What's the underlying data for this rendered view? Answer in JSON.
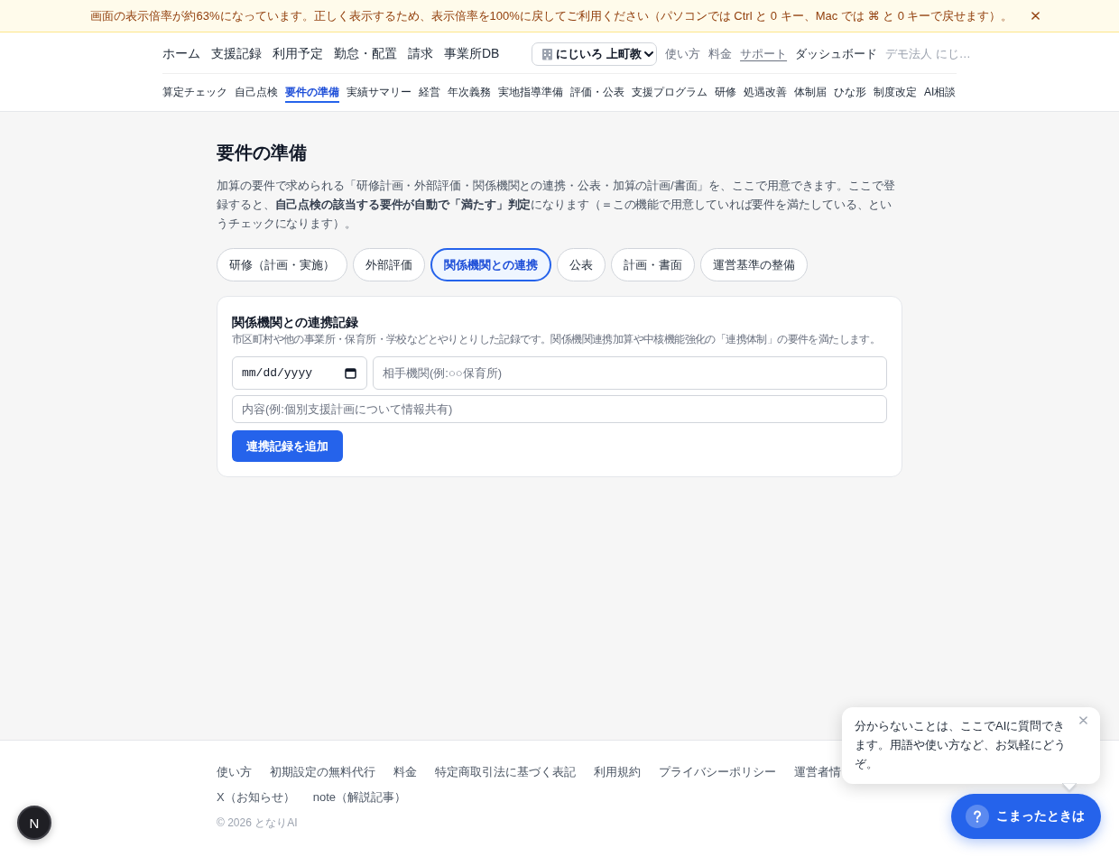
{
  "zoom_banner": {
    "message": "画面の表示倍率が約63%になっています。正しく表示するため、表示倍率を100%に戻してご利用ください（パソコンでは Ctrl と 0 キー、Mac では ⌘ と 0 キーで戻せます）。"
  },
  "header": {
    "nav": [
      "ホーム",
      "支援記録",
      "利用予定",
      "勤怠・配置",
      "請求",
      "事業所DB"
    ],
    "facility_select": {
      "value": "にじいろ 上町教"
    },
    "links": [
      {
        "label": "使い方",
        "kind": "muted"
      },
      {
        "label": "料金",
        "kind": "muted"
      },
      {
        "label": "サポート",
        "kind": "underlined"
      },
      {
        "label": "ダッシュボード",
        "kind": "strong"
      },
      {
        "label": "デモ法人 にじ…",
        "kind": "faint"
      }
    ],
    "subnav": [
      {
        "label": "算定チェック",
        "selected": false
      },
      {
        "label": "自己点検",
        "selected": false
      },
      {
        "label": "要件の準備",
        "selected": true
      },
      {
        "label": "実績サマリー",
        "selected": false
      },
      {
        "label": "経営",
        "selected": false
      },
      {
        "label": "年次義務",
        "selected": false
      },
      {
        "label": "実地指導準備",
        "selected": false
      },
      {
        "label": "評価・公表",
        "selected": false
      },
      {
        "label": "支援プログラム",
        "selected": false
      },
      {
        "label": "研修",
        "selected": false
      },
      {
        "label": "処遇改善",
        "selected": false
      },
      {
        "label": "体制届",
        "selected": false
      },
      {
        "label": "ひな形",
        "selected": false
      },
      {
        "label": "制度改定",
        "selected": false
      },
      {
        "label": "AI相談",
        "selected": false
      }
    ]
  },
  "page": {
    "title": "要件の準備",
    "description": "加算の要件で求められる「研修計画・外部評価・関係機関との連携・公表・加算の計画/書面」を、ここで用意できます。ここで登録すると、**自己点検の該当する要件が自動で「満たす」判定**になります（＝この機能で用意していれば要件を満たしている、というチェックになります）。",
    "tabs": [
      {
        "label": "研修（計画・実施）",
        "selected": false
      },
      {
        "label": "外部評価",
        "selected": false
      },
      {
        "label": "関係機関との連携",
        "selected": true
      },
      {
        "label": "公表",
        "selected": false
      },
      {
        "label": "計画・書面",
        "selected": false
      },
      {
        "label": "運営基準の整備",
        "selected": false
      }
    ],
    "card": {
      "title": "関係機関との連携記録",
      "subtitle": "市区町村や他の事業所・保育所・学校などとやりとりした記録です。関係機関連携加算や中核機能強化の「連携体制」の要件を満たします。",
      "date_field": {
        "placeholder": "mm/dd/yyyy"
      },
      "partner_field": {
        "placeholder": "相手機関(例:○○保育所)"
      },
      "content_field": {
        "placeholder": "内容(例:個別支援計画について情報共有)"
      },
      "submit_button": "連携記録を追加"
    }
  },
  "footer": {
    "links": [
      "使い方",
      "初期設定の無料代行",
      "料金",
      "特定商取引法に基づく表記",
      "利用規約",
      "プライバシーポリシー",
      "運営者情",
      "X（お知らせ）",
      "note（解説記事）"
    ],
    "copyright": "© 2026 となりAI"
  },
  "dev_badge": {
    "label": "N"
  },
  "help_bubble": {
    "text": "分からないことは、ここでAIに質問できます。用語や使い方など、お気軽にどうぞ。"
  },
  "help_button": {
    "label": "こまったときは"
  }
}
